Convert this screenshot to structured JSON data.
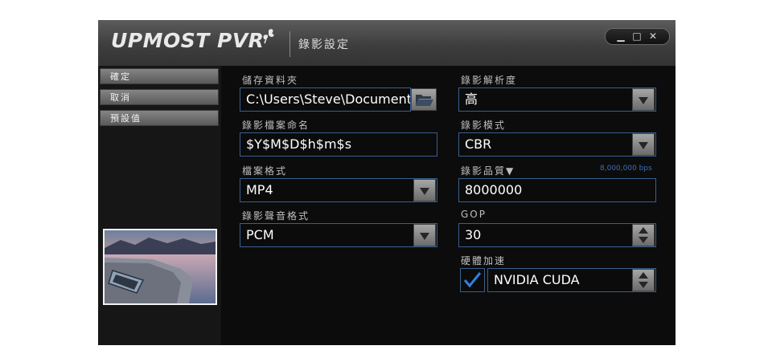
{
  "window": {
    "logo": "UPMOST PVR",
    "title": "錄影設定",
    "buttons": {
      "minimize": "▁",
      "maximize": "□",
      "close": "✕"
    }
  },
  "sidebar": {
    "items": [
      {
        "label": "確定"
      },
      {
        "label": "取消"
      },
      {
        "label": "預設值"
      }
    ]
  },
  "left_column": {
    "save_folder_label": "儲存資料夾",
    "save_folder_value": "C:\\Users\\Steve\\Documents",
    "filename_label": "錄影檔案命名",
    "filename_value": "$Y$M$D$h$m$s",
    "file_format_label": "檔案格式",
    "file_format_value": "MP4",
    "audio_format_label": "錄影聲音格式",
    "audio_format_value": "PCM"
  },
  "right_column": {
    "resolution_label": "錄影解析度",
    "resolution_value": "高",
    "mode_label": "錄影模式",
    "mode_value": "CBR",
    "quality_label": "錄影品質▼",
    "quality_bps": "8,000,000 bps",
    "quality_value": "8000000",
    "gop_label": "GOP",
    "gop_value": "30",
    "hw_accel_label": "硬體加速",
    "hw_accel_checked": true,
    "hw_accel_value": "NVIDIA CUDA"
  },
  "colors": {
    "field_border": "#3a5f8e",
    "accent_blue": "#3a6fbd",
    "check_blue": "#2f7fe0"
  }
}
